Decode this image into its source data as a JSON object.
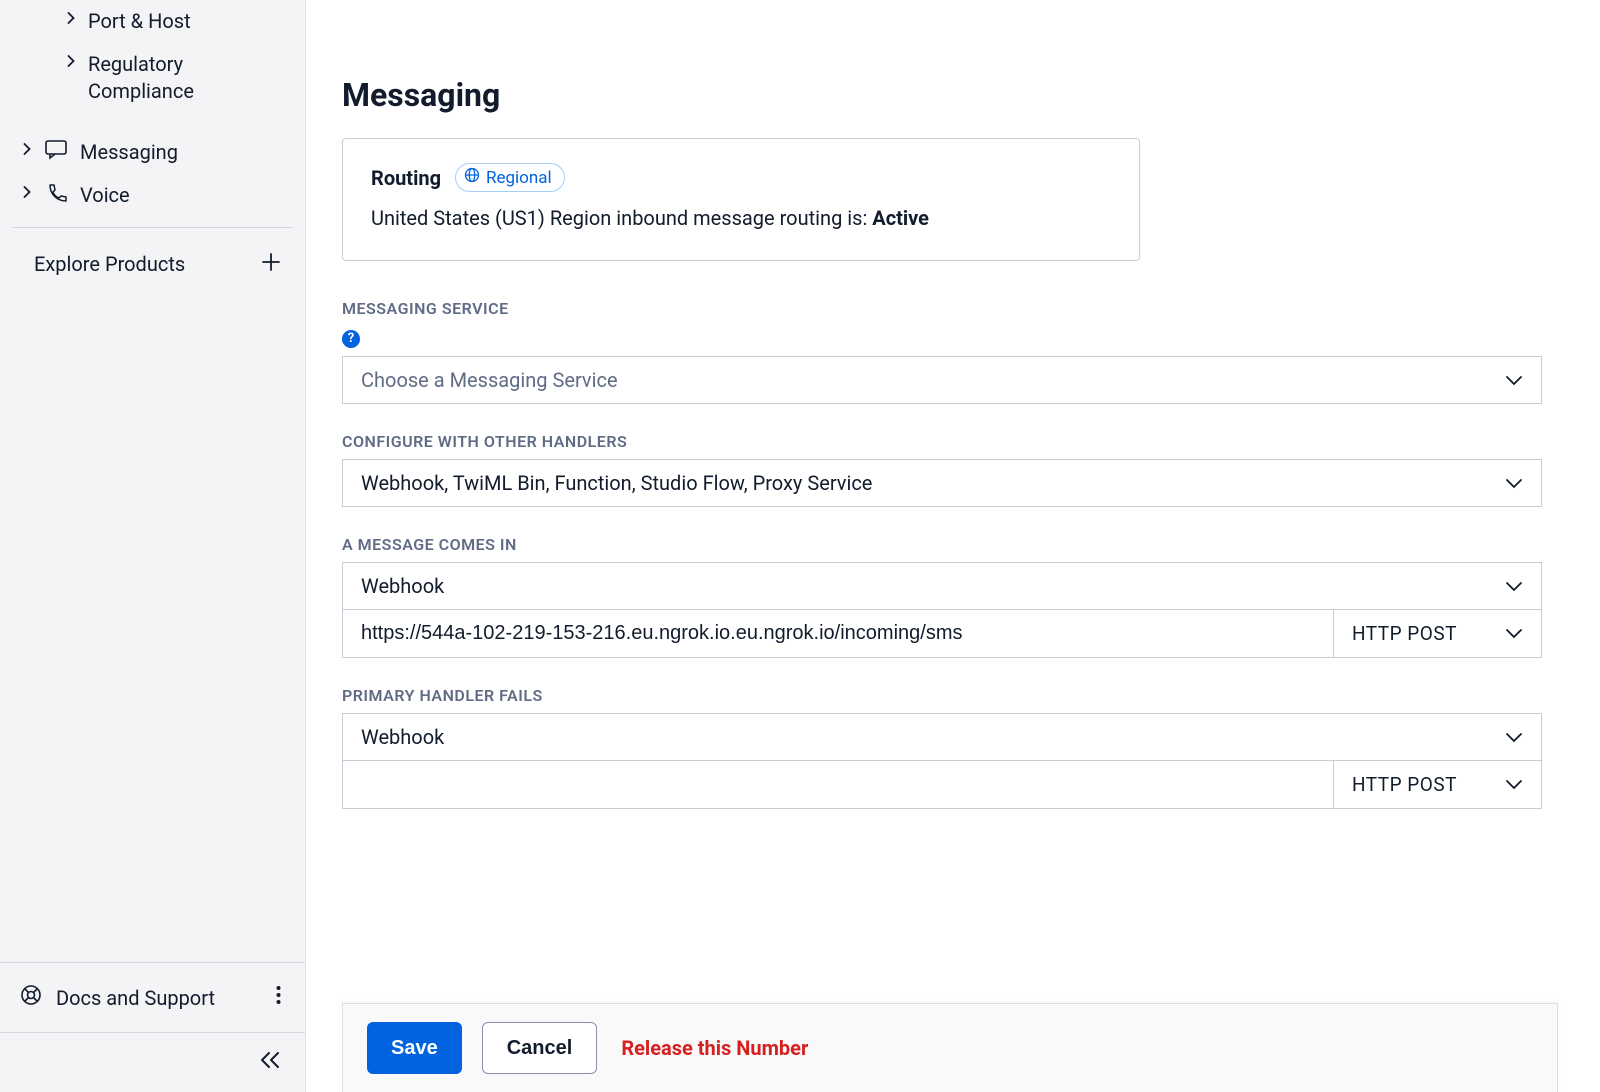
{
  "sidebar": {
    "items": [
      {
        "label": "Port & Host"
      },
      {
        "label": "Regulatory Compliance"
      },
      {
        "label": "Messaging"
      },
      {
        "label": "Voice"
      }
    ],
    "explore_label": "Explore Products",
    "docs_label": "Docs and Support"
  },
  "main": {
    "title": "Messaging",
    "routing": {
      "title": "Routing",
      "badge": "Regional",
      "text_prefix": "United States (US1) Region inbound message routing is: ",
      "status": "Active"
    },
    "sections": {
      "messaging_service": {
        "label": "MESSAGING SERVICE",
        "placeholder": "Choose a Messaging Service"
      },
      "configure_handlers": {
        "label": "CONFIGURE WITH OTHER HANDLERS",
        "value": "Webhook, TwiML Bin, Function, Studio Flow, Proxy Service"
      },
      "message_comes_in": {
        "label": "A MESSAGE COMES IN",
        "handler": "Webhook",
        "url": "https://544a-102-219-153-216.eu.ngrok.io.eu.ngrok.io/incoming/sms",
        "method": "HTTP POST"
      },
      "primary_handler_fails": {
        "label": "PRIMARY HANDLER FAILS",
        "handler": "Webhook",
        "url": "",
        "method": "HTTP POST"
      }
    },
    "actions": {
      "save": "Save",
      "cancel": "Cancel",
      "release": "Release this Number"
    }
  }
}
